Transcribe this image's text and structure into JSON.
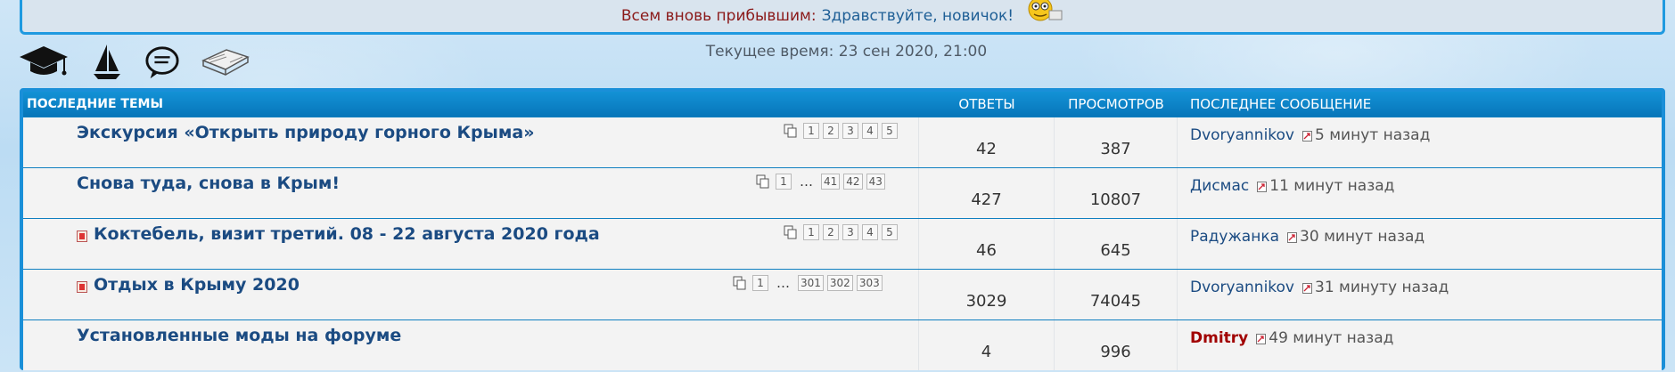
{
  "welcome": {
    "label": "Всем вновь прибывшим:",
    "text": "Здравствуйте, новичок!"
  },
  "toolbar": {
    "icons": [
      "graduation-cap-icon",
      "sailboat-icon",
      "speech-bubble-icon",
      "open-book-icon"
    ]
  },
  "current_time": "Текущее время: 23 сен 2020, 21:00",
  "table": {
    "headers": {
      "topic": "ПОСЛЕДНИЕ ТЕМЫ",
      "replies": "ОТВЕТЫ",
      "views": "ПРОСМОТРОВ",
      "last": "ПОСЛЕДНЕЕ СООБЩЕНИЕ"
    },
    "rows": [
      {
        "title": "Экскурсия «Открыть природу горного Крыма»",
        "unread": false,
        "pages": [
          "1",
          "2",
          "3",
          "4",
          "5"
        ],
        "replies": "42",
        "views": "387",
        "author": "Dvoryannikov",
        "time": "5 минут назад"
      },
      {
        "title": "Снова туда, снова в Крым!",
        "unread": false,
        "pages": [
          "1",
          "…",
          "41",
          "42",
          "43"
        ],
        "replies": "427",
        "views": "10807",
        "author": "Дисмас",
        "time": "11 минут назад"
      },
      {
        "title": "Коктебель, визит третий. 08 - 22 августа 2020 года",
        "unread": true,
        "pages": [
          "1",
          "2",
          "3",
          "4",
          "5"
        ],
        "replies": "46",
        "views": "645",
        "author": "Радужанка",
        "time": "30 минут назад"
      },
      {
        "title": "Отдых в Крыму 2020",
        "unread": true,
        "pages": [
          "1",
          "…",
          "301",
          "302",
          "303"
        ],
        "replies": "3029",
        "views": "74045",
        "author": "Dvoryannikov",
        "time": "31 минуту назад"
      },
      {
        "title": "Установленные моды на форуме",
        "unread": false,
        "pages": [],
        "replies": "4",
        "views": "996",
        "author": "Dmitry",
        "time": "49 минут назад"
      }
    ]
  },
  "colors": {
    "header_bg": "#0c7fc1",
    "topic_link": "#1b4b82",
    "admin_name": "#a10000",
    "welcome_label": "#8b1a1a"
  }
}
